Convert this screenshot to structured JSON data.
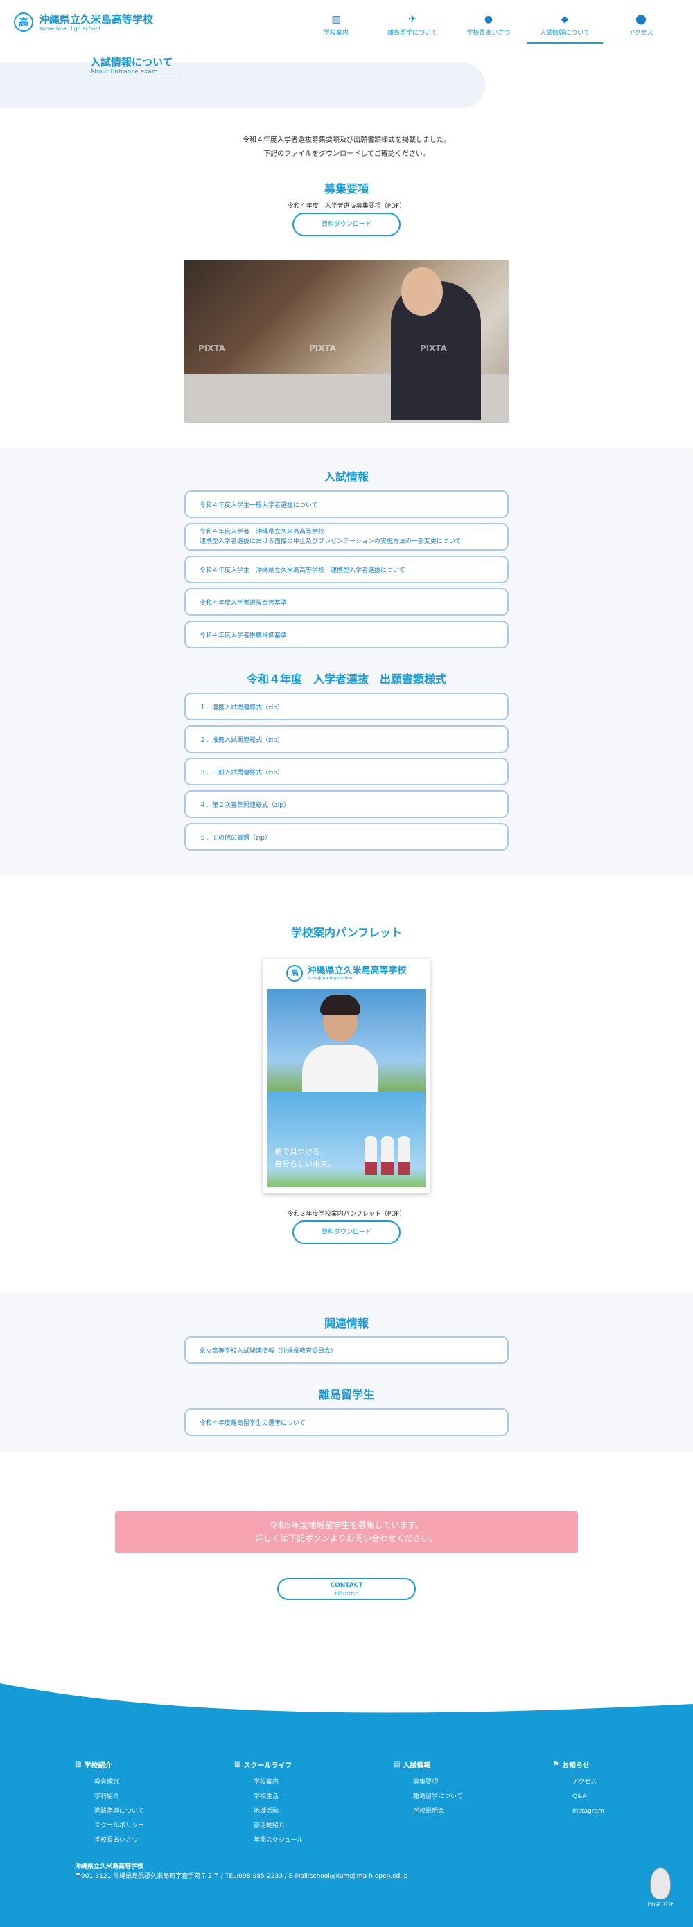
{
  "header": {
    "logo_jp": "沖縄県立久米島高等学校",
    "logo_en": "Kumejima High school",
    "logo_mark": "高",
    "nav": [
      {
        "label": "学校案内",
        "icon": "school-icon"
      },
      {
        "label": "離島留学について",
        "icon": "airplane-icon"
      },
      {
        "label": "学校長あいさつ",
        "icon": "person-icon"
      },
      {
        "label": "入試情報について",
        "icon": "graduation-cap-icon"
      },
      {
        "label": "アクセス",
        "icon": "map-pin-icon"
      }
    ]
  },
  "page": {
    "title": "入試情報について",
    "subtitle": "About Entrance exam",
    "intro_line1": "令和４年度入学者選抜募集要項及び出願書類様式を掲載しました。",
    "intro_line2": "下記のファイルをダウンロードしてご確認ください。"
  },
  "recruit": {
    "heading": "募集要項",
    "caption": "令和４年度　入学者選抜募集要項（PDF）",
    "button": "資料ダウンロード",
    "watermark": "PIXTA"
  },
  "exam_info": {
    "heading": "入試情報",
    "links": [
      "令和４年度入学生一般入学者選抜について",
      "令和４年度入学者　沖縄県立久米島高等学校",
      "令和４年度入学生　沖縄県立久米島高等学校　連携型入学者選抜について",
      "令和４年度入学者選抜合否基準",
      "令和４年度入学者推薦評価基準"
    ],
    "link2_line2": "連携型入学者選抜における面接の中止及びプレゼンテーションの実施方法の一部変更について"
  },
  "forms": {
    "heading": "令和４年度　入学者選抜　出願書類様式",
    "links": [
      "１．連携入試関連様式（zip）",
      "２．推薦入試関連様式（zip）",
      "３．一般入試関連様式（zip）",
      "４．第２次募集関連様式（zip）",
      "５．その他の書類（zip）"
    ]
  },
  "pamphlet": {
    "heading": "学校案内パンフレット",
    "cover_title": "沖縄県立久米島高等学校",
    "cover_en": "Kumejima High school",
    "cover_mark": "高",
    "cover_copy1": "島で見つける、",
    "cover_copy2": "自分らしい未来。",
    "caption": "令和３年度学校案内パンフレット（PDF）",
    "button": "資料ダウンロード"
  },
  "related": {
    "heading": "関連情報",
    "link": "県立高等学校入試関連情報（沖縄県教育委員会）"
  },
  "island": {
    "heading": "離島留学生",
    "link": "令和４年度離島留学生の選考について"
  },
  "notice": {
    "line1": "令和5年度地域留学生を募集しています。",
    "line2": "詳しくは下記ボタンよりお問い合わせください。"
  },
  "contact": {
    "label": "CONTACT",
    "sub": "お問い合わせ"
  },
  "footer": {
    "cols": [
      {
        "heading": "学校紹介",
        "icon": "school-icon",
        "items": [
          "教育理念",
          "学科紹介",
          "進路指導について",
          "スクールポリシー",
          "学校長あいさつ"
        ]
      },
      {
        "heading": "スクールライフ",
        "icon": "building-icon",
        "items": [
          "学校案内",
          "学校生活",
          "地域活動",
          "部活動紹介",
          "年間スケジュール"
        ]
      },
      {
        "heading": "入試情報",
        "icon": "document-icon",
        "items": [
          "募集要項",
          "離島留学について",
          "学校説明会"
        ]
      },
      {
        "heading": "お知らせ",
        "icon": "flag-icon",
        "items": [
          "アクセス",
          "Q&A",
          "Instagram"
        ]
      }
    ],
    "school_name": "沖縄県立久米島高等学校",
    "address": "〒901-3121 沖縄県島尻郡久米島町字嘉手苅７２７ / TEL:098-985-2233 / E-Mail:school@kumejima-h.open.ed.jp",
    "pagetop": "PAGE TOP"
  },
  "colors": {
    "accent": "#1a9bd7",
    "footer": "#159bd6",
    "notice": "#f5a3b1",
    "band": "#f5f7fa"
  }
}
